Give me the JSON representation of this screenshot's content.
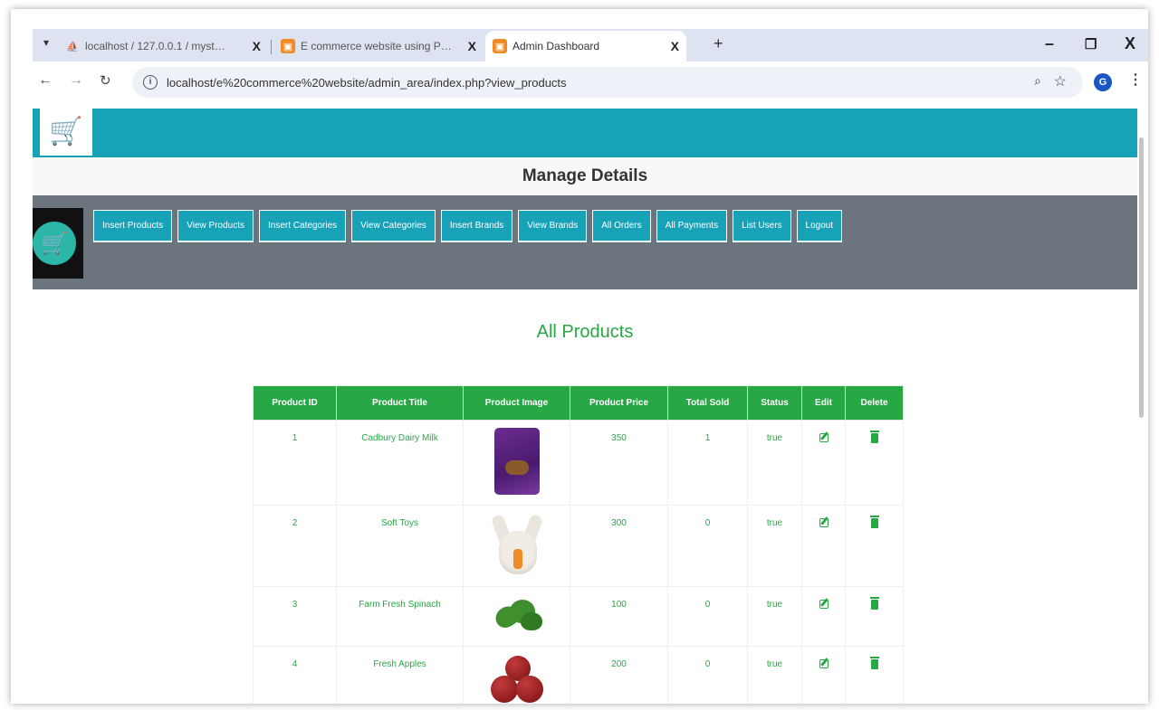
{
  "browser": {
    "tabs": [
      {
        "title": "localhost / 127.0.0.1 / mystore /",
        "close": "X"
      },
      {
        "title": "E commerce website using PHP",
        "close": "X"
      },
      {
        "title": "Admin Dashboard",
        "close": "X"
      }
    ],
    "new_tab": "+",
    "url": "localhost/e%20commerce%20website/admin_area/index.php?view_products",
    "profile_initial": "G",
    "window_controls": {
      "minimize": "–",
      "maximize": "❐",
      "close": "X"
    }
  },
  "page": {
    "manage_title": "Manage Details",
    "nav_buttons": [
      "Insert Products",
      "View Products",
      "Insert Categories",
      "View Categories",
      "Insert Brands",
      "View Brands",
      "All Orders",
      "All Payments",
      "List Users",
      "Logout"
    ],
    "products_title": "All Products",
    "table": {
      "headers": [
        "Product ID",
        "Product Title",
        "Product Image",
        "Product Price",
        "Total Sold",
        "Status",
        "Edit",
        "Delete"
      ],
      "rows": [
        {
          "id": "1",
          "title": "Cadbury Dairy Milk",
          "price": "350",
          "sold": "1",
          "status": "true"
        },
        {
          "id": "2",
          "title": "Soft Toys",
          "price": "300",
          "sold": "0",
          "status": "true"
        },
        {
          "id": "3",
          "title": "Farm Fresh Spinach",
          "price": "100",
          "sold": "0",
          "status": "true"
        },
        {
          "id": "4",
          "title": "Fresh Apples",
          "price": "200",
          "sold": "0",
          "status": "true"
        }
      ]
    }
  },
  "colors": {
    "header_teal": "#17a2b8",
    "nav_gray": "#6c757d",
    "green": "#28a745"
  },
  "icons": [
    "cart-logo-icon",
    "edit-icon",
    "trash-icon",
    "info-icon",
    "zoom-icon",
    "star-icon"
  ]
}
